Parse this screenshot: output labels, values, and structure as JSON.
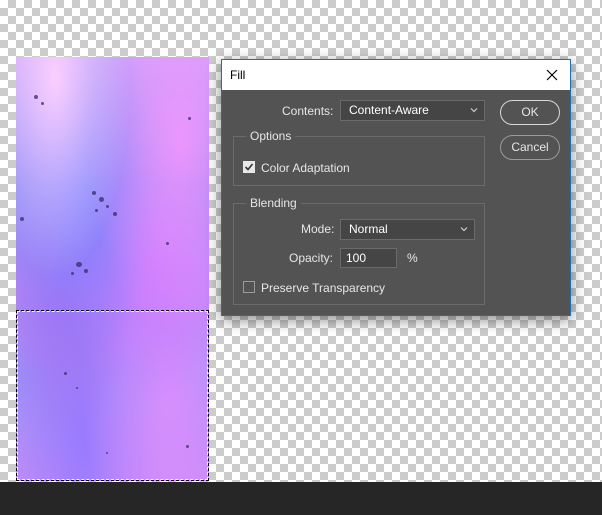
{
  "dialog": {
    "title": "Fill",
    "contents_label": "Contents:",
    "contents_value": "Content-Aware",
    "options_group": {
      "title": "Options",
      "color_adaptation_label": "Color Adaptation",
      "color_adaptation_checked": true
    },
    "blending_group": {
      "title": "Blending",
      "mode_label": "Mode:",
      "mode_value": "Normal",
      "opacity_label": "Opacity:",
      "opacity_value": "100",
      "opacity_unit": "%",
      "preserve_transparency_label": "Preserve Transparency",
      "preserve_transparency_checked": false
    },
    "buttons": {
      "ok_label": "OK",
      "cancel_label": "Cancel"
    }
  },
  "icons": {
    "close": "close-icon",
    "dropdown": "chevron-down-icon",
    "check": "check-icon"
  },
  "colors": {
    "dialog_bg": "#535353",
    "titlebar_bg": "#ffffff",
    "dialog_border": "#1f6fb3",
    "bottom_bar": "#262626"
  }
}
